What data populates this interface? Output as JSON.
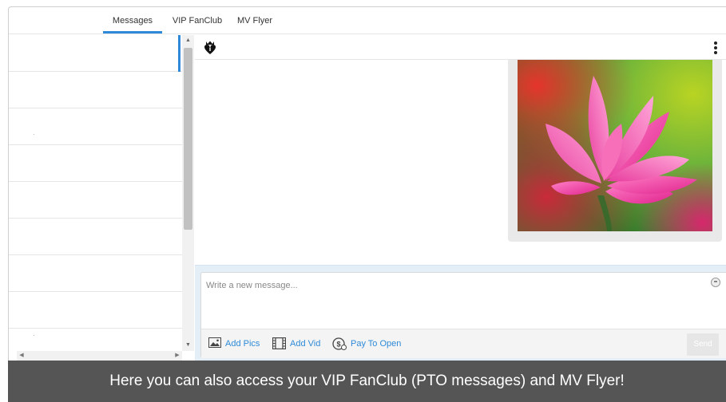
{
  "tabs": [
    {
      "label": "Messages",
      "active": true
    },
    {
      "label": "VIP FanClub",
      "active": false
    },
    {
      "label": "MV Flyer",
      "active": false
    }
  ],
  "colors": {
    "accent": "#2e8ad8",
    "tooltip_bg": "#505050",
    "composer_bg": "#e3eef7"
  },
  "chat": {
    "header_icon": "vip-heart-crown-icon",
    "menu_icon": "kebab-menu-icon",
    "message_image": "pink-lotus-flower-photo"
  },
  "composer": {
    "placeholder": "Write a new message...",
    "value": "",
    "emoji_icon": "smiley-icon",
    "add_pics": "Add Pics",
    "add_vid": "Add Vid",
    "pay_to_open": "Pay To Open",
    "send": "Send"
  },
  "tooltip": {
    "text": "Here you can also access your VIP FanClub (PTO messages) and MV Flyer!"
  }
}
